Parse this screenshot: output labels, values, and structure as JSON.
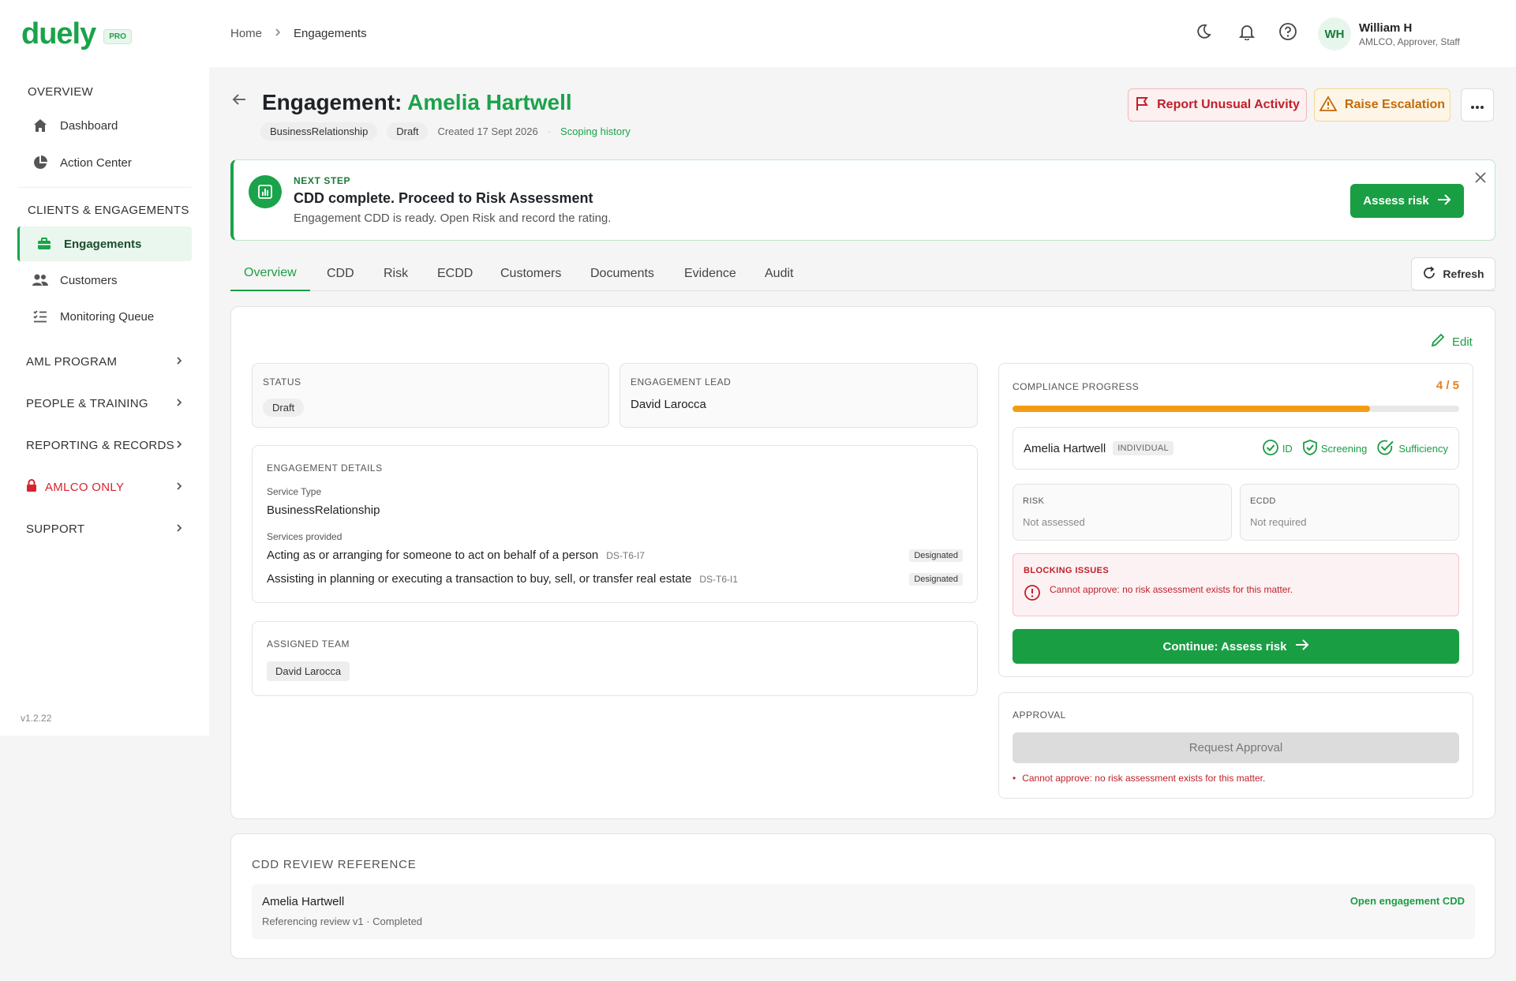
{
  "brand": {
    "name": "duely",
    "badge": "PRO"
  },
  "sidebar": {
    "sections": [
      {
        "title": "OVERVIEW"
      },
      {
        "title": "CLIENTS & ENGAGEMENTS"
      }
    ],
    "items": [
      {
        "label": "Dashboard",
        "icon": "home-icon"
      },
      {
        "label": "Action Center",
        "icon": "pie-chart-icon"
      },
      {
        "label": "Engagements",
        "icon": "briefcase-icon",
        "active": true
      },
      {
        "label": "Customers",
        "icon": "users-icon"
      },
      {
        "label": "Monitoring Queue",
        "icon": "checklist-icon"
      }
    ],
    "groups": [
      {
        "label": "AML PROGRAM"
      },
      {
        "label": "PEOPLE & TRAINING"
      },
      {
        "label": "REPORTING & RECORDS"
      },
      {
        "label": "AMLCO ONLY",
        "color": "#d9232e",
        "icon": "lock-icon"
      },
      {
        "label": "SUPPORT"
      }
    ],
    "version": "v1.2.22"
  },
  "topbar": {
    "breadcrumb": [
      "Home",
      "Engagements"
    ],
    "user": {
      "initials": "WH",
      "name": "William H",
      "role": "AMLCO, Approver, Staff"
    }
  },
  "header": {
    "title_prefix": "Engagement:",
    "title_name": "Amelia Hartwell",
    "chips": [
      "BusinessRelationship",
      "Draft"
    ],
    "created": "Created 17 Sept 2026",
    "scoping_link": "Scoping history",
    "report_label": "Report Unusual Activity",
    "escalation_label": "Raise Escalation"
  },
  "banner": {
    "eyebrow": "NEXT STEP",
    "title": "CDD complete. Proceed to Risk Assessment",
    "subtitle": "Engagement CDD is ready. Open Risk and record the rating.",
    "button": "Assess risk"
  },
  "tabs": [
    "Overview",
    "CDD",
    "Risk",
    "ECDD",
    "Customers",
    "Documents",
    "Evidence",
    "Audit"
  ],
  "refresh_label": "Refresh",
  "overview": {
    "edit_label": "Edit",
    "status": {
      "label": "STATUS",
      "value": "Draft"
    },
    "lead": {
      "label": "ENGAGEMENT LEAD",
      "value": "David Larocca"
    },
    "details": {
      "label": "ENGAGEMENT DETAILS",
      "service_type_label": "Service Type",
      "service_type": "BusinessRelationship",
      "services_label": "Services provided",
      "services": [
        {
          "text": "Acting as or arranging for someone to act on behalf of a person",
          "code": "DS-T6-I7",
          "tag": "Designated"
        },
        {
          "text": "Assisting in planning or executing a transaction to buy, sell, or transfer real estate",
          "code": "DS-T6-I1",
          "tag": "Designated"
        }
      ]
    },
    "team": {
      "label": "ASSIGNED TEAM",
      "members": [
        "David Larocca"
      ]
    },
    "compliance": {
      "label": "COMPLIANCE PROGRESS",
      "count": "4 / 5",
      "progress": 0.8,
      "customer": "Amelia Hartwell",
      "customer_type": "INDIVIDUAL",
      "checks": [
        "ID",
        "Screening",
        "Sufficiency"
      ],
      "risk_label": "RISK",
      "risk_value": "Not assessed",
      "ecdd_label": "ECDD",
      "ecdd_value": "Not required",
      "blocking_label": "BLOCKING ISSUES",
      "blocking_text": "Cannot approve: no risk assessment exists for this matter.",
      "continue_label": "Continue: Assess risk"
    },
    "approval": {
      "label": "APPROVAL",
      "button": "Request Approval",
      "note": "Cannot approve: no risk assessment exists for this matter."
    }
  },
  "cdd_review": {
    "heading": "CDD REVIEW REFERENCE",
    "name": "Amelia Hartwell",
    "sub": "Referencing review v1 · Completed",
    "link": "Open engagement CDD"
  },
  "colors": {
    "accent": "#1aa34a",
    "danger": "#d9232e",
    "warning": "#f39c12"
  }
}
